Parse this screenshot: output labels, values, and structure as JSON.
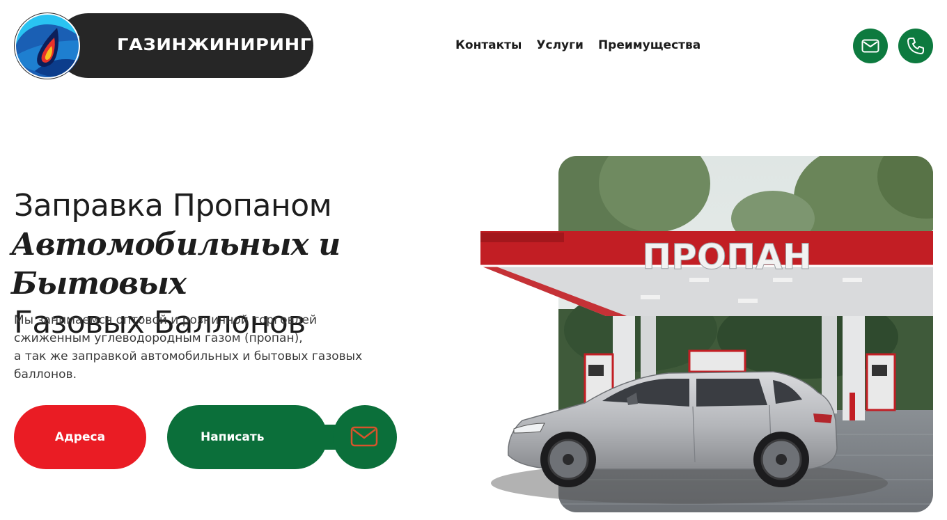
{
  "brand": {
    "name": "ГАЗИНЖИНИРИНГ"
  },
  "nav": {
    "items": [
      "Контакты",
      "Услуги",
      "Преимущества"
    ]
  },
  "header_actions": {
    "email_icon": "mail-icon",
    "phone_icon": "phone-icon"
  },
  "hero": {
    "title_line1": "Заправка Пропаном",
    "title_line2": "Автомобильных и Бытовых",
    "title_line3": "Газовых Баллонов",
    "description_lines": [
      "Мы занимаемся оптовой и розничной торговлей",
      "сжиженным углеводородным газом (пропан),",
      "а так же заправкой автомобильных и бытовых газовых",
      "баллонов."
    ]
  },
  "buttons": {
    "addresses": "Адреса",
    "write": "Написать"
  },
  "illustration": {
    "sign_text": "ПРОПАН"
  },
  "colors": {
    "green": "#0b6f3a",
    "red": "#ea1c24",
    "dark": "#262626",
    "text": "#1d1d1d"
  }
}
